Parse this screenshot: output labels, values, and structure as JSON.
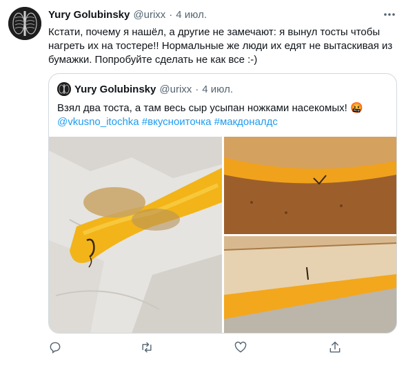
{
  "tweet": {
    "author_name": "Yury Golubinsky",
    "author_handle": "@urixx",
    "separator": "·",
    "date": "4 июл.",
    "text": "Кстати, почему я нашёл, а другие не замечают: я вынул тосты чтобы нагреть их на тостере!! Нормальные же люди их едят не вытаскивая из бумажки. Попробуйте сделать не как все :-)"
  },
  "quoted_tweet": {
    "author_name": "Yury Golubinsky",
    "author_handle": "@urixx",
    "separator": "·",
    "date": "4 июл.",
    "text_main": "Взял два тоста, а там весь сыр усыпан ножками насекомых! 🤬",
    "mention": "@vkusno_itochka",
    "hashtag_1": "#вкусноиточка",
    "hashtag_2": "#макдоналдс"
  },
  "icons": {
    "more": "more-dots-icon",
    "reply": "reply-icon",
    "retweet": "retweet-icon",
    "like": "heart-icon",
    "share": "share-icon"
  },
  "colors": {
    "text": "#0f1419",
    "muted": "#536471",
    "link": "#1d9bf0",
    "border": "#cfd9de"
  }
}
